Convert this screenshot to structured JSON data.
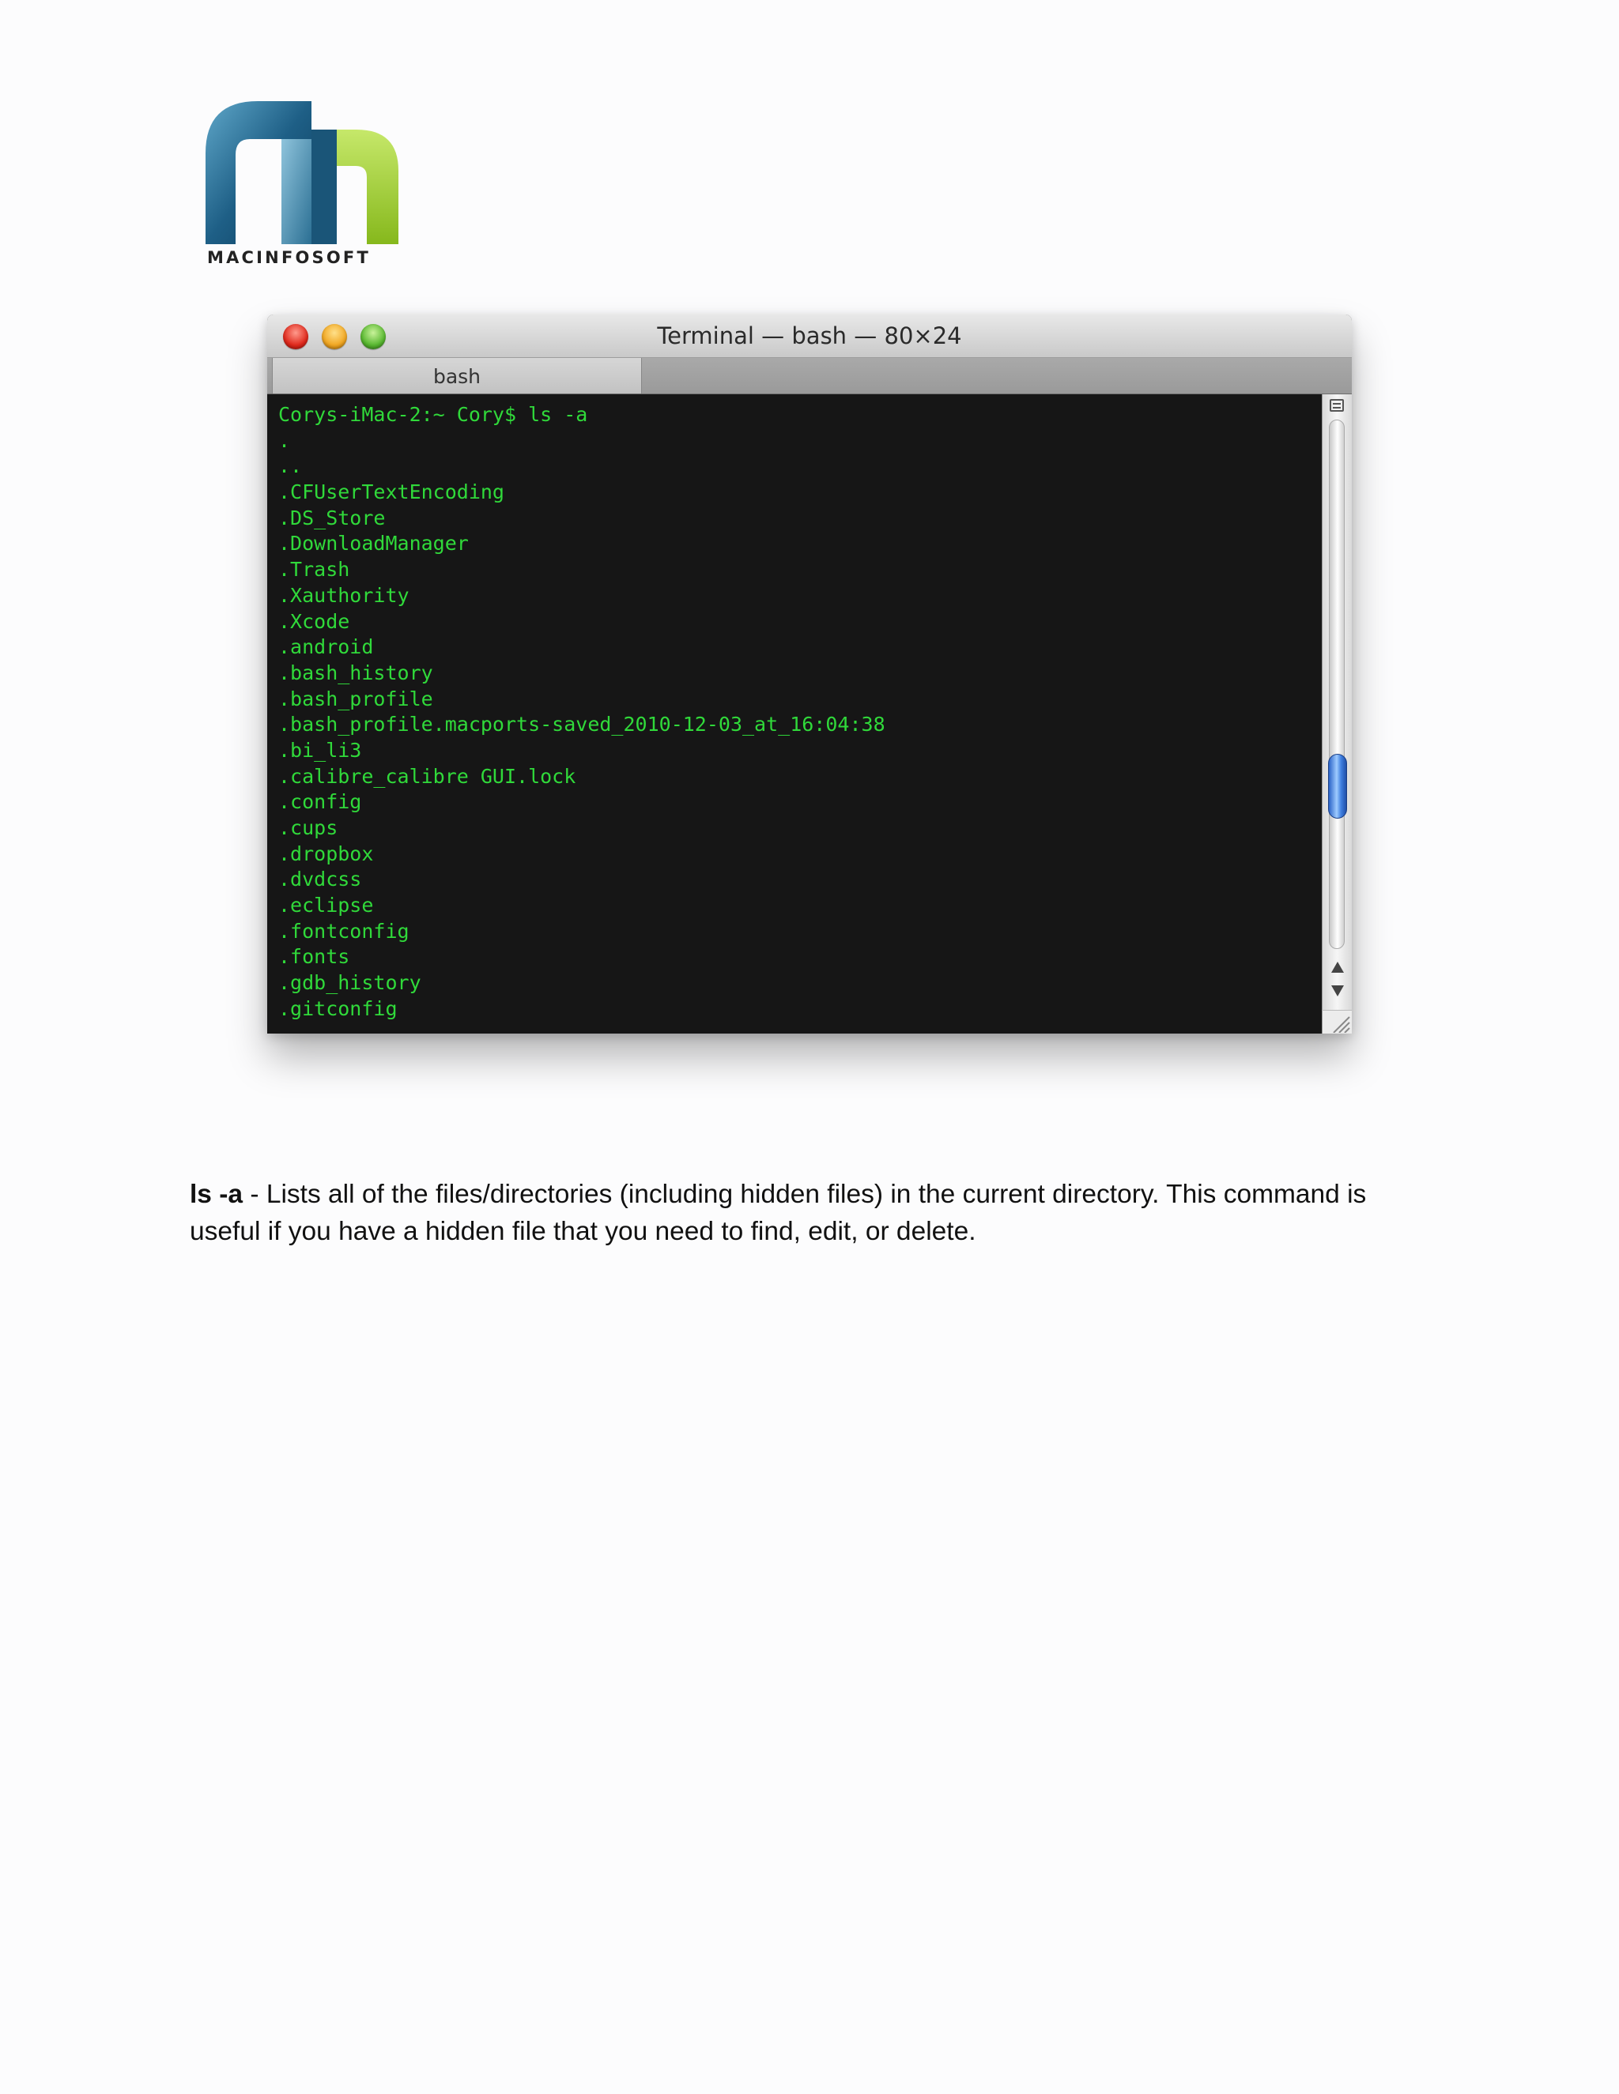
{
  "logo": {
    "wordmark": "MACINFOSOFT",
    "colors": {
      "dark_blue": "#0d4a70",
      "mid_blue": "#3b8cb3",
      "lime": "#9ccc2a"
    }
  },
  "terminal": {
    "title": "Terminal — bash — 80×24",
    "tab_label": "bash",
    "text_color": "#30d93a",
    "background_color": "#161616",
    "scroll_position": 0.72,
    "lines": [
      "Corys-iMac-2:~ Cory$ ls -a",
      ".",
      "..",
      ".CFUserTextEncoding",
      ".DS_Store",
      ".DownloadManager",
      ".Trash",
      ".Xauthority",
      ".Xcode",
      ".android",
      ".bash_history",
      ".bash_profile",
      ".bash_profile.macports-saved_2010-12-03_at_16:04:38",
      ".bi_li3",
      ".calibre_calibre GUI.lock",
      ".config",
      ".cups",
      ".dropbox",
      ".dvdcss",
      ".eclipse",
      ".fontconfig",
      ".fonts",
      ".gdb_history",
      ".gitconfig"
    ]
  },
  "description": {
    "command": "ls -a",
    "separator": " - ",
    "text": "Lists all of the files/directories (including hidden files) in the current directory. This command is useful if you have a hidden file that you need to find, edit, or delete."
  }
}
